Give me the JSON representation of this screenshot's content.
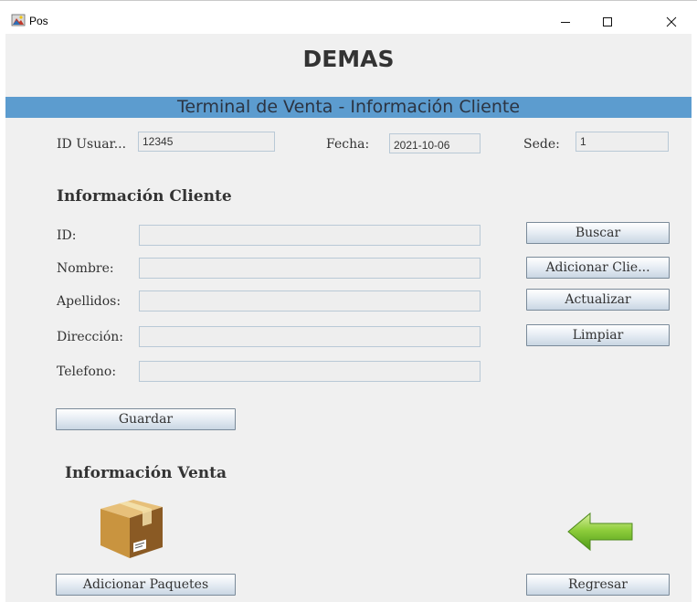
{
  "window": {
    "title": "Pos",
    "icon": "java-app-icon",
    "controls": [
      "minimize-icon",
      "maximize-icon",
      "close-icon"
    ]
  },
  "app": {
    "title": "DEMAS",
    "banner": "Terminal de Venta - Información Cliente"
  },
  "session": {
    "user_label": "ID Usuar...",
    "user_value": "12345",
    "date_label": "Fecha:",
    "date_value": "2021-10-06",
    "site_label": "Sede:",
    "site_value": "1"
  },
  "client": {
    "header": "Información Cliente",
    "fields": {
      "id_label": "ID:",
      "name_label": "Nombre:",
      "lastname_label": "Apellidos:",
      "address_label": "Dirección:",
      "phone_label": "Telefono:"
    },
    "buttons": {
      "search": "Buscar",
      "add": "Adicionar Clie...",
      "update": "Actualizar",
      "clear": "Limpiar",
      "save": "Guardar"
    }
  },
  "sale": {
    "header": "Información Venta",
    "add_packages": "Adicionar Paquetes",
    "back": "Regresar"
  },
  "colors": {
    "banner": "#5c9ccf",
    "background": "#f0f0f0",
    "arrow": "#7cc23a"
  }
}
